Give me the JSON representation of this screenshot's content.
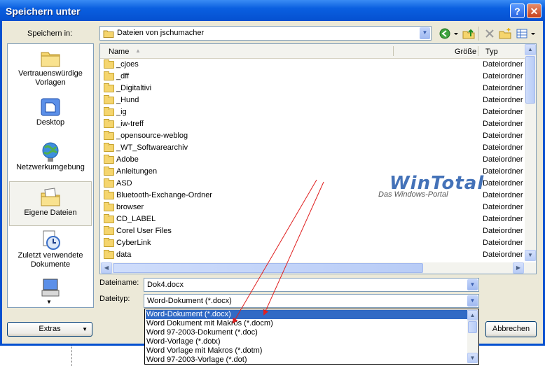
{
  "window": {
    "title": "Speichern unter"
  },
  "titlebar": {
    "help_glyph": "?",
    "close_glyph": "✕"
  },
  "save_in": {
    "label": "Speichern in:",
    "value": "Dateien von jschumacher"
  },
  "places": [
    {
      "label": "Vertrauenswürdige Vorlagen",
      "icon": "folder-icon"
    },
    {
      "label": "Desktop",
      "icon": "desktop-icon"
    },
    {
      "label": "Netzwerkumgebung",
      "icon": "network-icon"
    },
    {
      "label": "Eigene Dateien",
      "icon": "my-documents-icon",
      "selected": true
    },
    {
      "label": "Zuletzt verwendete Dokumente",
      "icon": "recent-documents-icon"
    }
  ],
  "columns": {
    "name": "Name",
    "size": "Größe",
    "type": "Typ"
  },
  "files": [
    {
      "name": "_cjoes",
      "type": "Dateiordner"
    },
    {
      "name": "_dff",
      "type": "Dateiordner"
    },
    {
      "name": "_Digitaltivi",
      "type": "Dateiordner"
    },
    {
      "name": "_Hund",
      "type": "Dateiordner"
    },
    {
      "name": "_ig",
      "type": "Dateiordner"
    },
    {
      "name": "_iw-treff",
      "type": "Dateiordner"
    },
    {
      "name": "_opensource-weblog",
      "type": "Dateiordner"
    },
    {
      "name": "_WT_Softwarearchiv",
      "type": "Dateiordner"
    },
    {
      "name": "Adobe",
      "type": "Dateiordner"
    },
    {
      "name": "Anleitungen",
      "type": "Dateiordner"
    },
    {
      "name": "ASD",
      "type": "Dateiordner"
    },
    {
      "name": "Bluetooth-Exchange-Ordner",
      "type": "Dateiordner"
    },
    {
      "name": "browser",
      "type": "Dateiordner"
    },
    {
      "name": "CD_LABEL",
      "type": "Dateiordner"
    },
    {
      "name": "Corel User Files",
      "type": "Dateiordner"
    },
    {
      "name": "CyberLink",
      "type": "Dateiordner"
    },
    {
      "name": "data",
      "type": "Dateiordner"
    }
  ],
  "watermark": {
    "brand": "WinTotal",
    "tagline": "Das Windows-Portal"
  },
  "filename": {
    "label": "Dateiname:",
    "value": "Dok4.docx"
  },
  "filetype": {
    "label": "Dateityp:",
    "value": "Word-Dokument (*.docx)",
    "options": [
      "Word-Dokument (*.docx)",
      "Word Dokument mit Makros (*.docm)",
      "Word 97-2003-Dokument (*.doc)",
      "Word-Vorlage (*.dotx)",
      "Word Vorlage mit Makros (*.dotm)",
      "Word 97-2003-Vorlage (*.dot)"
    ]
  },
  "buttons": {
    "extras": "Extras",
    "cancel": "Abbrechen"
  },
  "colors": {
    "titlebar": "#0550D0",
    "selection": "#316AC5",
    "arrow": "#E02020"
  }
}
